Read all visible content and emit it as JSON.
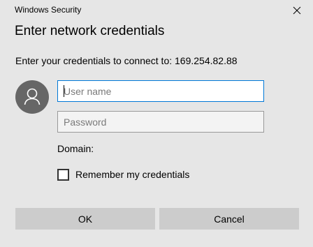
{
  "window": {
    "title": "Windows Security",
    "close_icon": "close-icon"
  },
  "dialog": {
    "heading": "Enter network credentials",
    "connect_text": "Enter your credentials to connect to: 169.254.82.88",
    "avatar_icon": "user-avatar-icon"
  },
  "form": {
    "username": {
      "placeholder": "User name",
      "value": ""
    },
    "password": {
      "placeholder": "Password",
      "value": ""
    },
    "domain_label": "Domain:",
    "remember_label": "Remember my credentials",
    "remember_checked": false
  },
  "buttons": {
    "ok": "OK",
    "cancel": "Cancel"
  },
  "colors": {
    "background": "#e6e6e6",
    "focus_border": "#0078d7",
    "button_bg": "#cccccc",
    "avatar_bg": "#666666"
  }
}
